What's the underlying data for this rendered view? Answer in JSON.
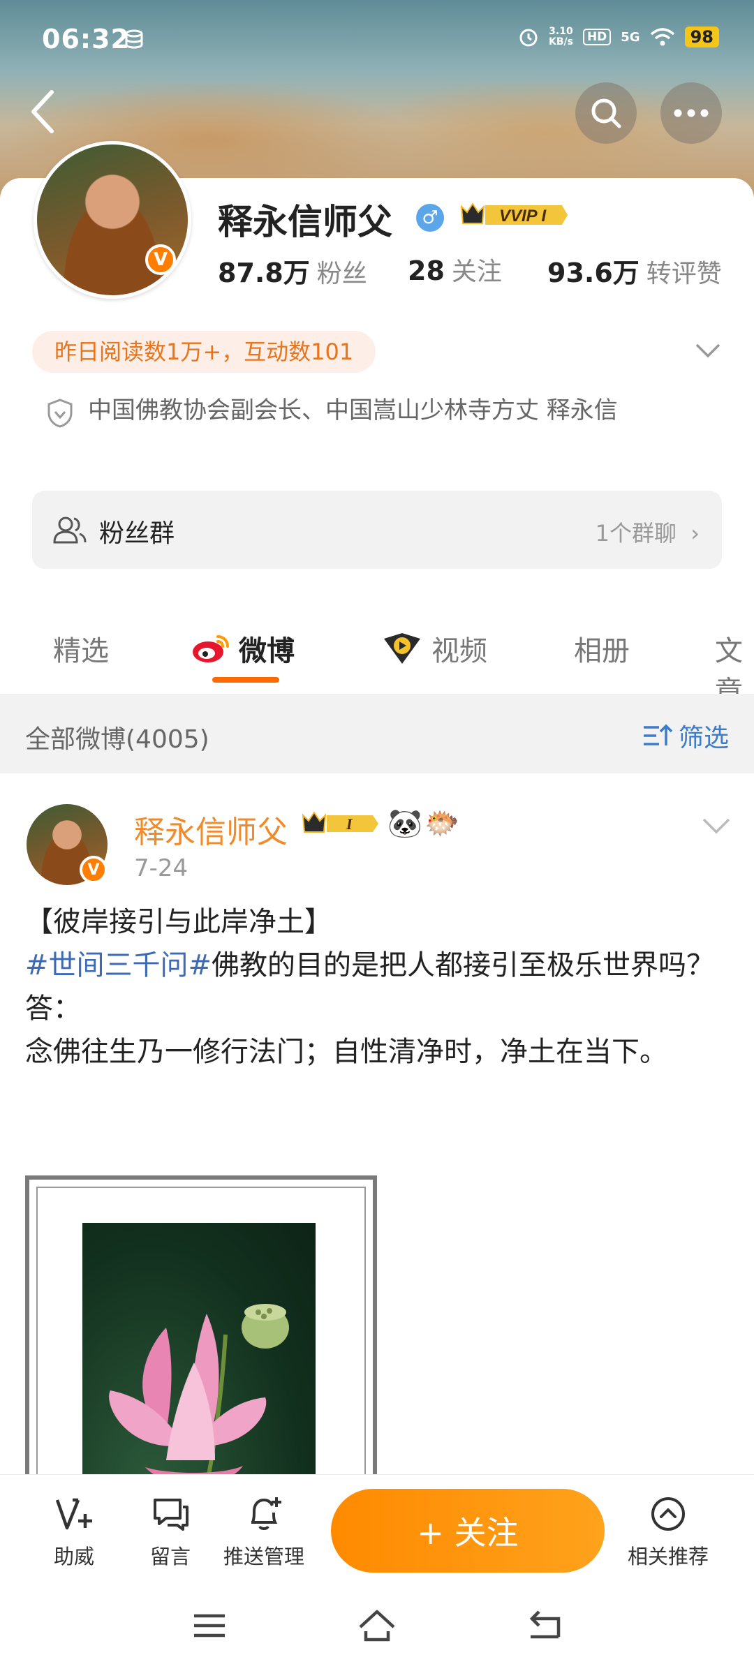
{
  "status_bar": {
    "time": "06:32",
    "net_speed_value": "3.10",
    "net_speed_unit": "KB/s",
    "hd": "HD",
    "signal": "5G",
    "battery": "98"
  },
  "profile": {
    "name": "释永信师父",
    "vip_label": "VVIP I",
    "stats": [
      {
        "value": "87.8万",
        "label": "粉丝"
      },
      {
        "value": "28",
        "label": "关注"
      },
      {
        "value": "93.6万",
        "label": "转评赞"
      }
    ],
    "highlight": "昨日阅读数1万+，互动数101",
    "bio": "中国佛教协会副会长、中国嵩山少林寺方丈 释永信",
    "fan_group": {
      "label": "粉丝群",
      "count": "1个群聊"
    }
  },
  "tabs": [
    {
      "label": "精选"
    },
    {
      "label": "微博"
    },
    {
      "label": "视频"
    },
    {
      "label": "相册"
    },
    {
      "label": "文章"
    }
  ],
  "filter": {
    "title": "全部微博(4005)",
    "button": "筛选"
  },
  "post": {
    "author": "释永信师父",
    "badge_label": "I",
    "date": "7-24",
    "title_line": "【彼岸接引与此岸净土】",
    "hashtag": "#世间三千问#",
    "line1_rest": "佛教的目的是把人都接引至极乐世界吗？",
    "answer_label": "答：",
    "answer": "念佛往生乃一修行法门；自性清净时，净土在当下。"
  },
  "bottom_bar": {
    "actions": [
      {
        "label": "助威"
      },
      {
        "label": "留言"
      },
      {
        "label": "推送管理"
      }
    ],
    "follow": "+ 关注",
    "related": "相关推荐"
  },
  "colors": {
    "accent": "#ff8a00",
    "link": "#3c6ab4",
    "username": "#f08a2a"
  }
}
